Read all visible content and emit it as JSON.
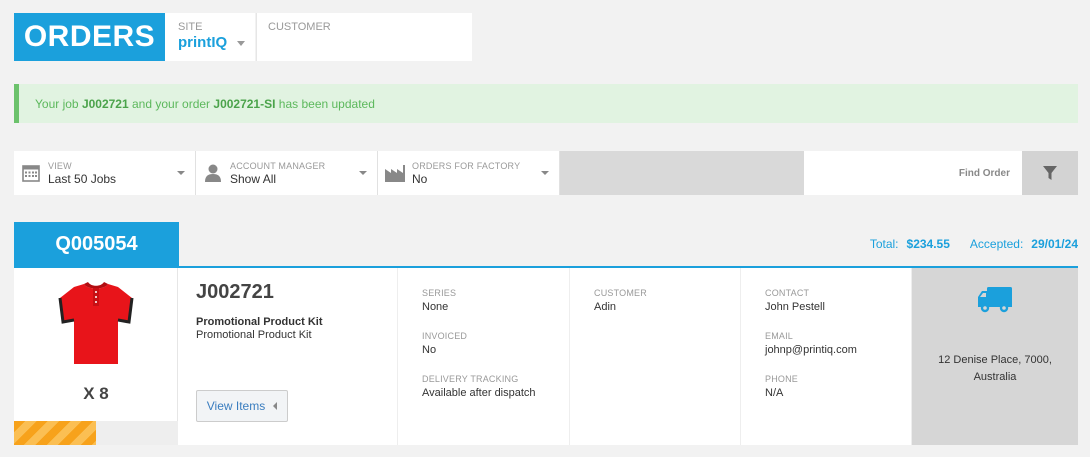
{
  "header": {
    "title": "ORDERS",
    "site_label": "SITE",
    "site_value": "printIQ",
    "customer_label": "CUSTOMER"
  },
  "alert": {
    "prefix": "Your job ",
    "job": "J002721",
    "middle": " and your order ",
    "order": "J002721-SI",
    "suffix": " has been updated"
  },
  "filters": {
    "view": {
      "label": "VIEW",
      "value": "Last 50 Jobs"
    },
    "manager": {
      "label": "ACCOUNT MANAGER",
      "value": "Show All"
    },
    "factory": {
      "label": "ORDERS FOR FACTORY",
      "value": "No"
    },
    "find_order": "Find Order"
  },
  "quote": {
    "number": "Q005054",
    "total_label": "Total:",
    "total_value": "$234.55",
    "accepted_label": "Accepted:",
    "accepted_value": "29/01/24"
  },
  "job": {
    "quantity": "X 8",
    "progress_fraction": 0.5,
    "number": "J002721",
    "title": "Promotional Product Kit",
    "subtitle": "Promotional Product Kit",
    "view_items_label": "View Items",
    "series_label": "SERIES",
    "series_value": "None",
    "invoiced_label": "INVOICED",
    "invoiced_value": "No",
    "tracking_label": "DELIVERY TRACKING",
    "tracking_value": "Available after dispatch",
    "customer_label": "CUSTOMER",
    "customer_value": "Adin",
    "contact_label": "CONTACT",
    "contact_value": "John Pestell",
    "email_label": "EMAIL",
    "email_value": "johnp@printiq.com",
    "phone_label": "PHONE",
    "phone_value": "N/A",
    "address_line1": "12 Denise Place, 7000,",
    "address_line2": "Australia"
  },
  "colors": {
    "accent": "#1ba0dc",
    "success": "#5cb85c",
    "progress": "#f7a21b"
  },
  "icons": {
    "view": "calendar-icon",
    "manager": "user-icon",
    "factory": "factory-icon",
    "filter": "funnel-icon",
    "delivery": "truck-icon",
    "product": "shirt-thumbnail"
  }
}
